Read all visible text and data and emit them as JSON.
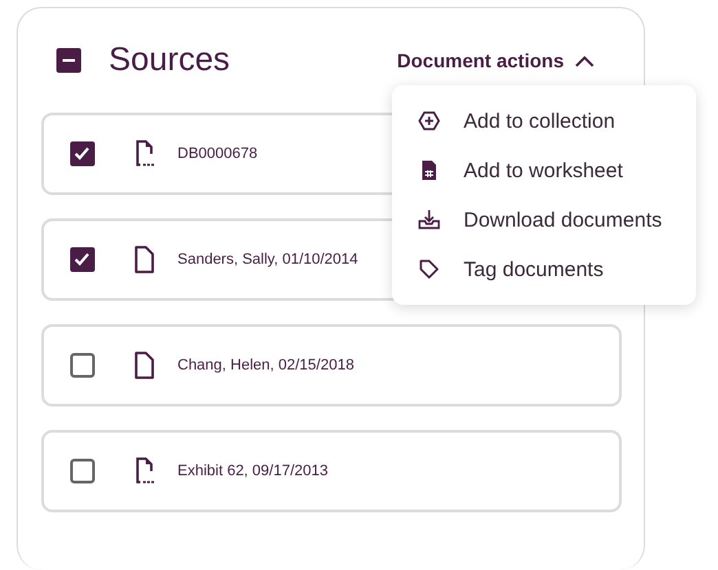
{
  "panel": {
    "title": "Sources",
    "partially_selected": true
  },
  "actions": {
    "label": "Document actions",
    "expanded": true,
    "items": [
      {
        "label": "Add to collection",
        "kind": "collection"
      },
      {
        "label": "Add to worksheet",
        "kind": "worksheet"
      },
      {
        "label": "Download documents",
        "kind": "download"
      },
      {
        "label": "Tag documents",
        "kind": "tag"
      }
    ]
  },
  "documents": [
    {
      "name": "DB0000678",
      "kind": "pdf",
      "checked": true
    },
    {
      "name": "Sanders, Sally, 01/10/2014",
      "kind": "doc",
      "checked": true
    },
    {
      "name": "Chang, Helen, 02/15/2018",
      "kind": "doc",
      "checked": false
    },
    {
      "name": "Exhibit 62, 09/17/2013",
      "kind": "pdf",
      "checked": false
    }
  ]
}
